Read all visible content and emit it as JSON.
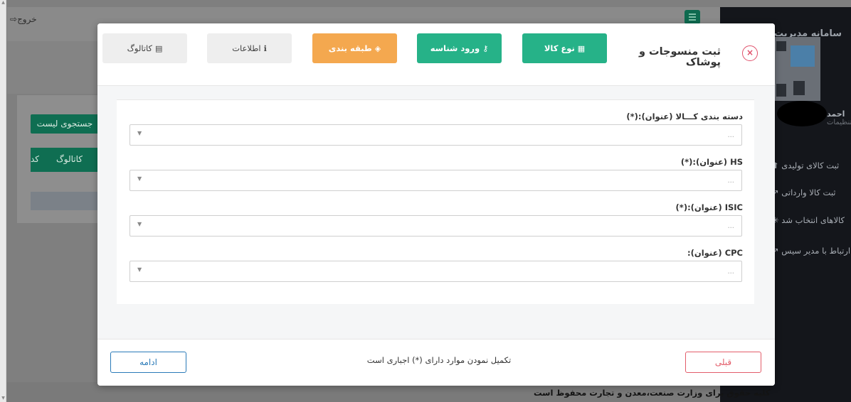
{
  "background": {
    "logout_label": "خروج",
    "search_list_label": "جستجوی لیست",
    "table_header_catalog": "کاتالوگ",
    "table_header_code": "کد",
    "sidebar_title": "سامانه مدیریت ش",
    "user_name": "احمد",
    "user_sub": "تنظیمات",
    "nav_items": [
      {
        "icon": "arrow-up-icon",
        "label": "ثبت کالای تولیدی"
      },
      {
        "icon": "external-link-icon",
        "label": "ثبت کالا وارداتی"
      },
      {
        "icon": "spinner-icon",
        "label": "کالاهای انتخاب شد"
      },
      {
        "icon": "external-link-icon",
        "label": "ارتباط با مدیر سیس"
      }
    ],
    "footer_text": "کلیه حقوق برای وزارت صنعت،معدن و تجارت محفوظ است"
  },
  "modal": {
    "title": "ثبت منسوجات و پوشاک",
    "close_glyph": "×",
    "tabs": [
      {
        "label": "نوع کالا",
        "icon": "grid-icon",
        "glyph": "▦",
        "style": "green"
      },
      {
        "label": "ورود شناسه",
        "icon": "key-icon",
        "glyph": "⚷",
        "style": "green"
      },
      {
        "label": "طبقه بندی",
        "icon": "tag-icon",
        "glyph": "◈",
        "style": "orange"
      },
      {
        "label": "اطلاعات",
        "icon": "info-icon",
        "glyph": "ℹ",
        "style": "gray"
      },
      {
        "label": "کاتالوگ",
        "icon": "file-icon",
        "glyph": "▤",
        "style": "gray"
      }
    ],
    "fields": [
      {
        "label": "دسته بندی کـــالا (عنوان):(*)",
        "value": "..."
      },
      {
        "label": "HS (عنوان):(*)",
        "value": "..."
      },
      {
        "label": "ISIC (عنوان):(*)",
        "value": "..."
      },
      {
        "label": "CPC (عنوان):",
        "value": "..."
      }
    ],
    "footer_note": "تکمیل نمودن موارد دارای (*) اجباری است",
    "prev_label": "قبلی",
    "next_label": "ادامه"
  },
  "colors": {
    "tab_active": "#26b288",
    "tab_current": "#f4a84f",
    "tab_inactive": "#eeeeee",
    "close": "#e0506a",
    "prev_button": "#e35d6a",
    "next_button": "#2a7ab8"
  }
}
